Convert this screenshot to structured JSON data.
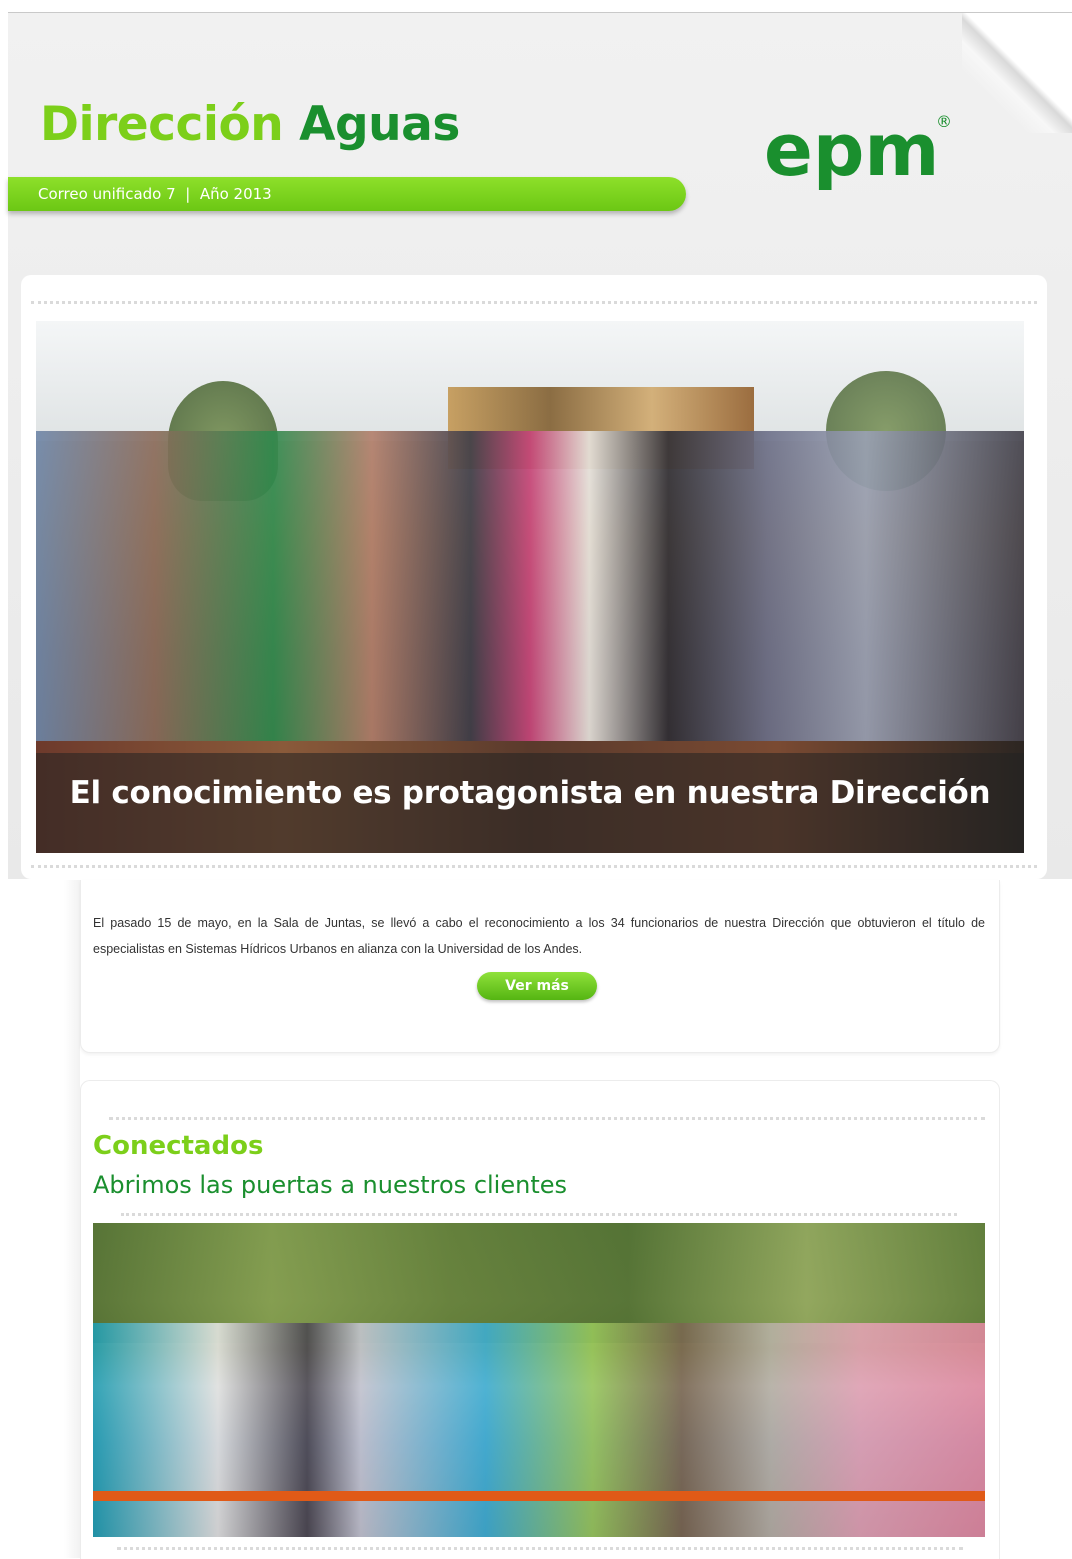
{
  "header": {
    "title_part1": "Dirección",
    "title_part2": "Aguas",
    "edition": "Correo unificado 7",
    "separator": "|",
    "year": "Año 2013",
    "logo_text": "epm",
    "logo_mark": "®"
  },
  "feature": {
    "photo_caption": "El conocimiento es protagonista en nuestra Dirección",
    "body": "El pasado 15 de mayo, en la Sala de Juntas, se llevó a cabo el reconocimiento a los 34 funcionarios de nuestra Dirección que obtuvieron el título de especialistas en Sistemas Hídricos Urbanos en alianza con la Universidad de los Andes.",
    "button_label": "Ver más"
  },
  "section": {
    "title": "Conectados",
    "subtitle": "Abrimos las puertas a nuestros clientes"
  },
  "colors": {
    "brand_green_light": "#7ccf1a",
    "brand_green_dark": "#1a8f2e",
    "button_green": "#6cc714"
  }
}
